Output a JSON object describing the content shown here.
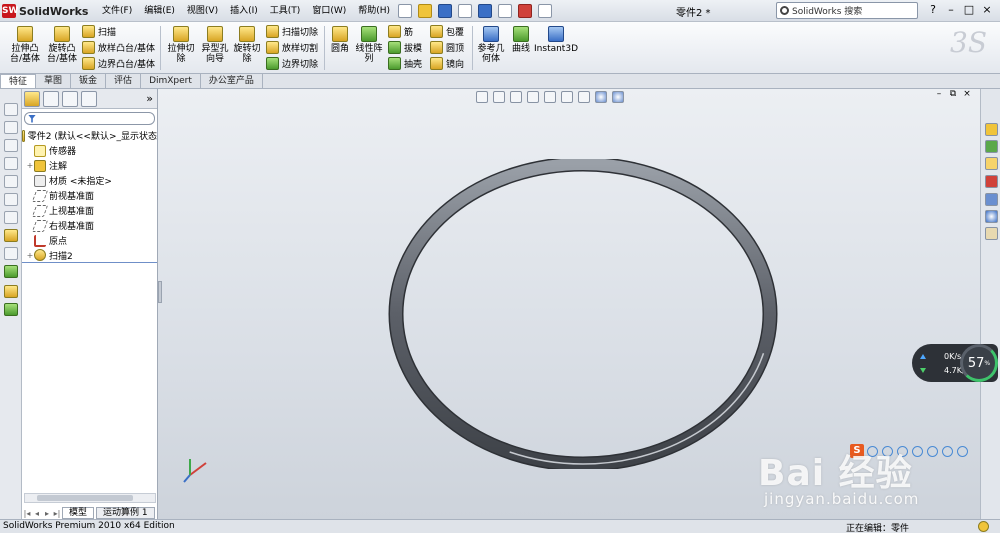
{
  "app": {
    "logo_text": "SolidWorks",
    "doc_title": "零件2 *"
  },
  "menu": {
    "items": [
      "文件(F)",
      "编辑(E)",
      "视图(V)",
      "插入(I)",
      "工具(T)",
      "窗口(W)",
      "帮助(H)"
    ]
  },
  "search": {
    "placeholder": "SolidWorks 搜索"
  },
  "window_controls": {
    "help": "?",
    "minimize": "–",
    "restore": "□",
    "close": "×"
  },
  "ribbon": {
    "extrude_boss": "拉伸凸\n台/基体",
    "revolve_boss": "旋转凸\n台/基体",
    "sweep": "扫描",
    "loft_boss": "放样凸台/基体",
    "boundary_boss": "边界凸台/基体",
    "extrude_cut": "拉伸切\n除",
    "hole_wizard": "异型孔\n向导",
    "revolve_cut": "旋转切\n除",
    "swept_cut": "扫描切除",
    "lofted_cut": "放样切割",
    "boundary_cut": "边界切除",
    "fillet": "圆角",
    "linear_pattern": "线性阵\n列",
    "rib": "筋",
    "draft": "拔模",
    "shell": "抽壳",
    "wrap": "包覆",
    "dome": "圆顶",
    "mirror": "镜向",
    "ref_geometry": "参考几\n何体",
    "curves": "曲线",
    "instant3d": "Instant3D"
  },
  "command_tabs": [
    "特征",
    "草图",
    "钣金",
    "评估",
    "DimXpert",
    "办公室产品"
  ],
  "feature_tree": {
    "root": "零件2  (默认<<默认>_显示状态",
    "items": [
      {
        "label": "传感器",
        "icon": "sensor-icon",
        "expand": ""
      },
      {
        "label": "注解",
        "icon": "annotation-icon",
        "expand": "+"
      },
      {
        "label": "材质 <未指定>",
        "icon": "material-icon",
        "expand": ""
      },
      {
        "label": "前视基准面",
        "icon": "plane-icon",
        "expand": ""
      },
      {
        "label": "上视基准面",
        "icon": "plane-icon",
        "expand": ""
      },
      {
        "label": "右视基准面",
        "icon": "plane-icon",
        "expand": ""
      },
      {
        "label": "原点",
        "icon": "origin-icon",
        "expand": ""
      },
      {
        "label": "扫描2",
        "icon": "sweep-icon",
        "expand": "+"
      }
    ]
  },
  "bottom_tabs": [
    "模型",
    "运动算例 1"
  ],
  "status_bar": {
    "left": "SolidWorks Premium 2010 x64 Edition",
    "right": "正在编辑：零件"
  },
  "net_monitor": {
    "up": "0K/s",
    "down": "4.7K/s",
    "percent": "57",
    "unit": "%"
  },
  "watermark": {
    "main": "Bai 经验",
    "sub": "jingyan.baidu.com"
  },
  "colors": {
    "ring": "#5c6068",
    "background_top": "#eceff3",
    "brand_red": "#c8161d"
  }
}
